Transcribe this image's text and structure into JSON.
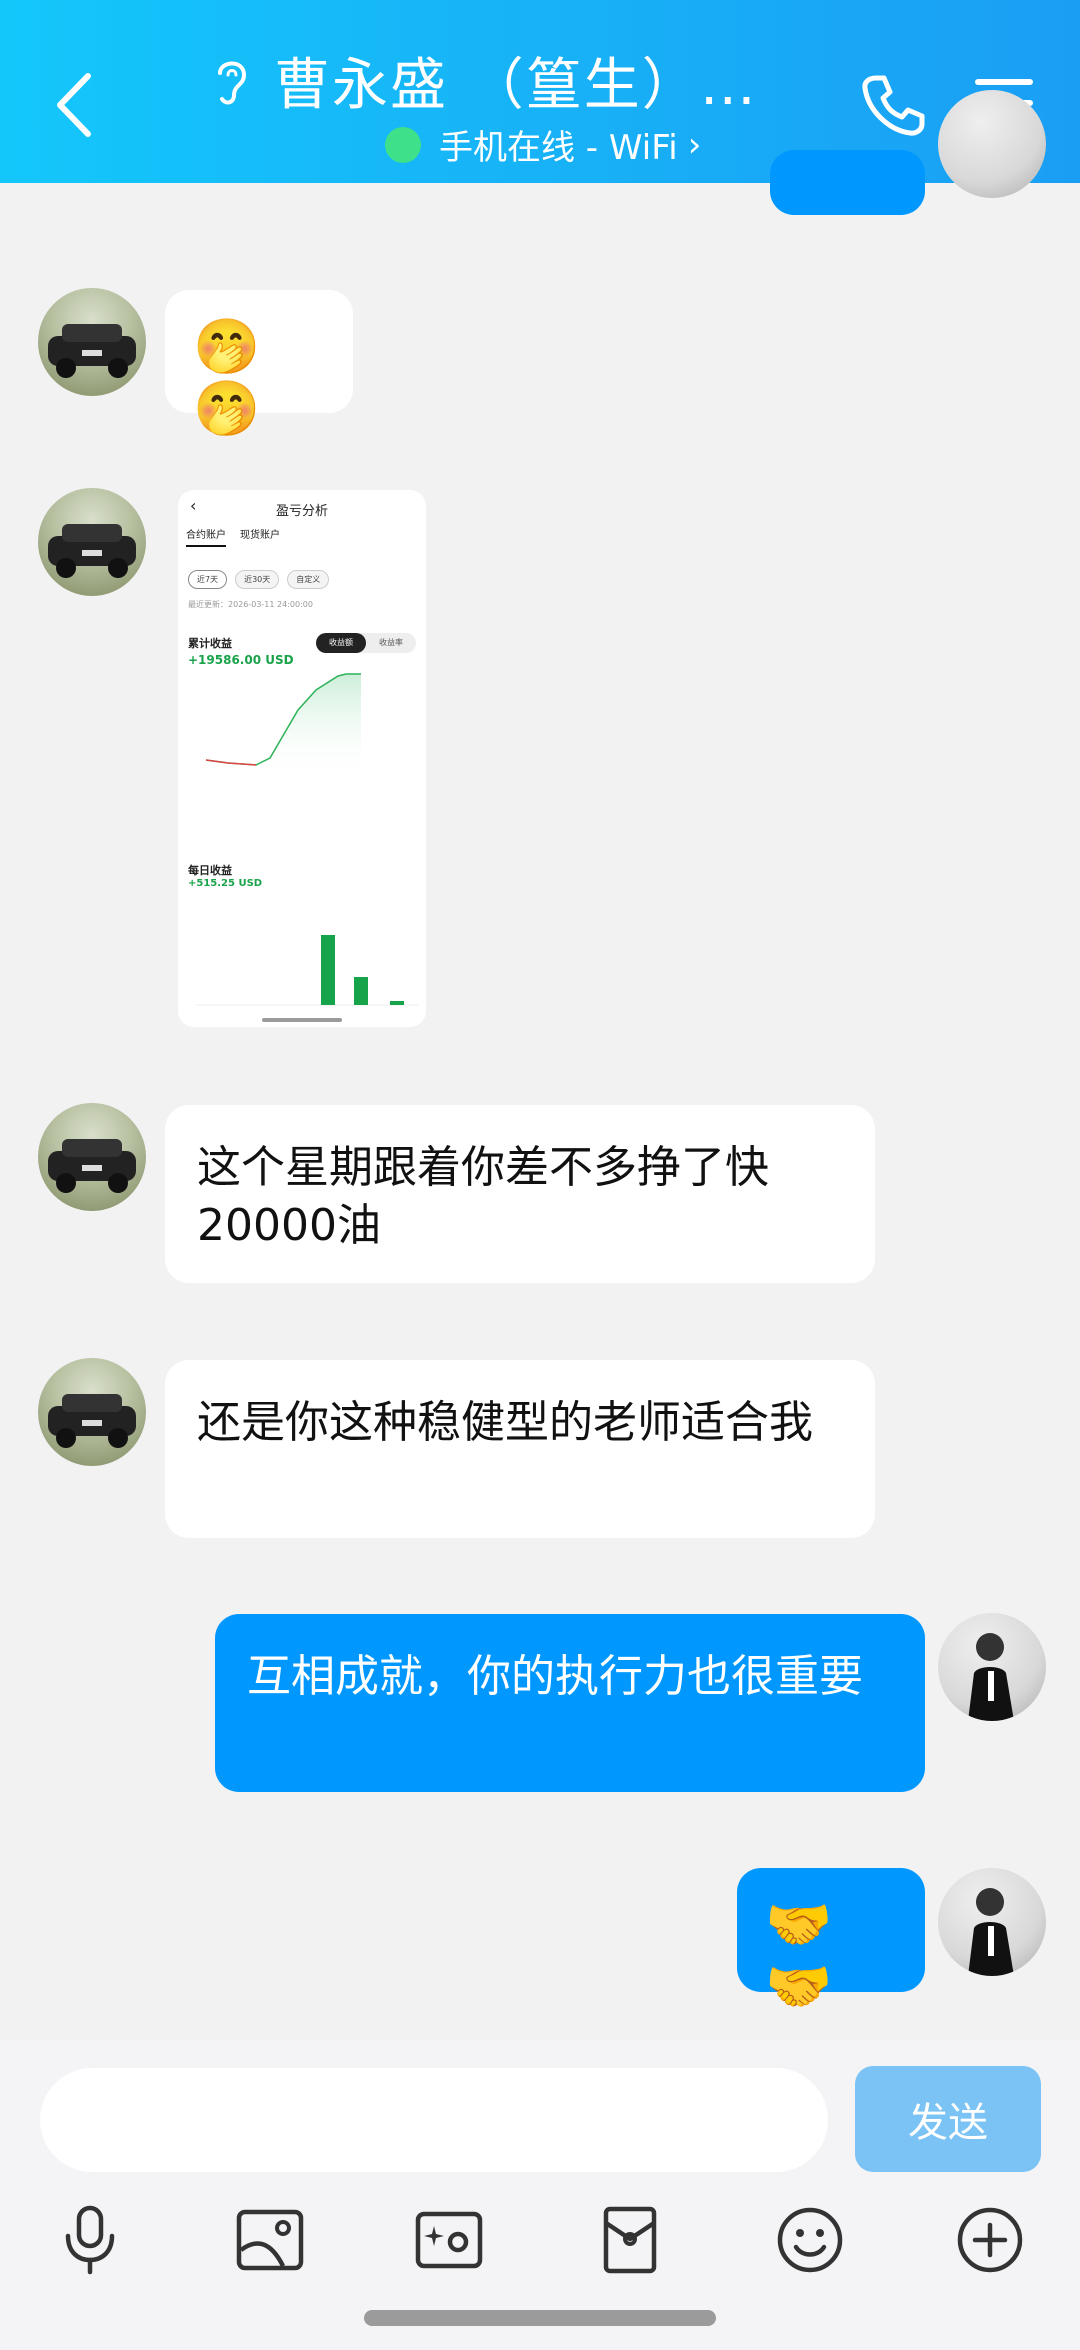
{
  "header": {
    "title": "曹永盛 （篁生）…",
    "status": "手机在线 - WiFi",
    "status_arrow": "›",
    "back_label": "返回",
    "colors": {
      "gradient_start": "#13c7fb",
      "gradient_end": "#1a9ef4",
      "online_dot": "#3ee089"
    }
  },
  "messages": [
    {
      "from": "other",
      "type": "emoji",
      "text": "🤭🤭"
    },
    {
      "from": "other",
      "type": "image",
      "image": {
        "title": "盈亏分析",
        "tabs": [
          "合约账户",
          "现货账户"
        ],
        "pills": [
          "近7天",
          "近30天",
          "自定义"
        ],
        "note": "最近更新：2026-03-11 24:00:00",
        "cumulative_label": "累计收益",
        "cumulative_value": "+19586.00 USD",
        "toggle": [
          "收益额",
          "收益率"
        ],
        "daily_label": "每日收益",
        "daily_value": "+515.25 USD"
      }
    },
    {
      "from": "other",
      "type": "text",
      "text": "这个星期跟着你差不多挣了快20000油"
    },
    {
      "from": "other",
      "type": "text",
      "text": "还是你这种稳健型的老师适合我"
    },
    {
      "from": "me",
      "type": "text",
      "text": "互相成就，你的执行力也很重要"
    },
    {
      "from": "me",
      "type": "emoji",
      "text": "🤝🤝"
    }
  ],
  "input": {
    "placeholder": "",
    "value": "",
    "send_label": "发送"
  },
  "toolbar": [
    "mic-icon",
    "image-icon",
    "camera-icon",
    "red-packet-icon",
    "emoji-icon",
    "plus-icon"
  ],
  "colors": {
    "outgoing_bubble": "#0098ff",
    "incoming_bubble": "#ffffff",
    "send_button": "#7cc3f5",
    "background": "#f2f2f2"
  }
}
